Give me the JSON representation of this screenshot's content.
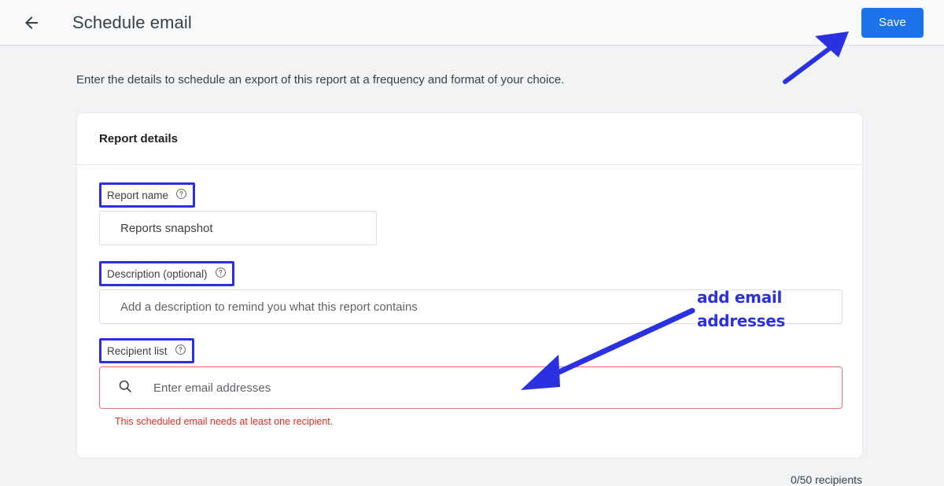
{
  "header": {
    "back_icon": "arrow-left-icon",
    "title": "Schedule email",
    "save_label": "Save"
  },
  "intro": {
    "text": "Enter the details to schedule an export of this report at a frequency and format of your choice."
  },
  "card": {
    "title": "Report details",
    "fields": {
      "report_name": {
        "label": "Report name",
        "help_icon": "help-circle-icon",
        "value": "Reports snapshot"
      },
      "description": {
        "label": "Description (optional)",
        "help_icon": "help-circle-icon",
        "placeholder": "Add a description to remind you what this report contains",
        "value": ""
      },
      "recipient_list": {
        "label": "Recipient list",
        "help_icon": "help-circle-icon",
        "search_icon": "search-icon",
        "placeholder": "Enter email addresses",
        "value": "",
        "error": "This scheduled email needs at least one recipient.",
        "counter": "0/50 recipients"
      }
    }
  },
  "annotations": {
    "caption": "add email addresses",
    "arrow_to_save": "arrow-annotation-up-right",
    "arrow_to_recipients": "arrow-annotation-down-left"
  },
  "colors": {
    "accent_blue": "#1a73e8",
    "annotation_blue": "#2b30e0",
    "error_red": "#d93025",
    "error_border": "#e57373",
    "page_bg": "#f1f3f4",
    "header_bg": "#f8f9fa"
  }
}
